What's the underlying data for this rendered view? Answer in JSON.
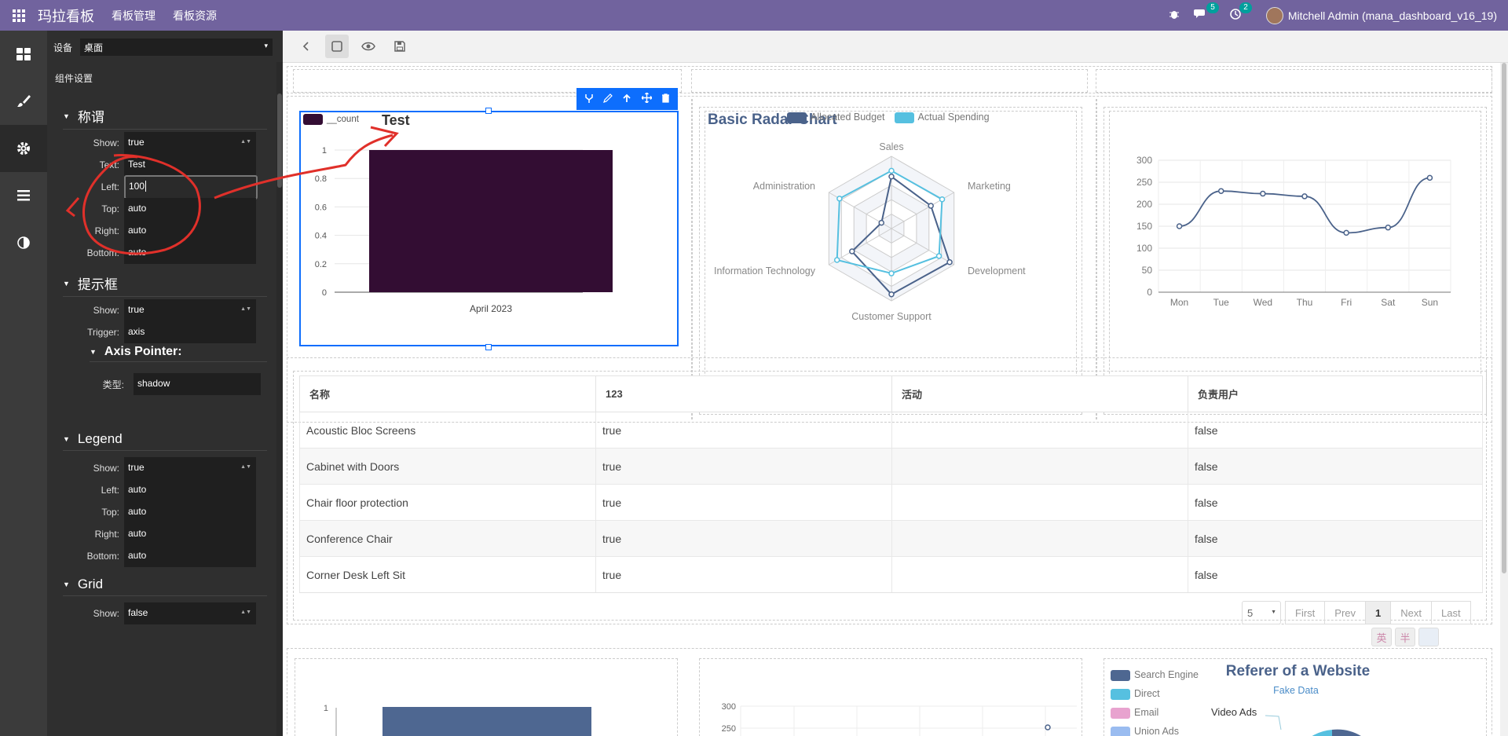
{
  "topbar": {
    "app_title": "玛拉看板",
    "menu": [
      "看板管理",
      "看板资源"
    ],
    "chat_badge": "5",
    "activity_badge": "2",
    "user": "Mitchell Admin (mana_dashboard_v16_19)"
  },
  "panel": {
    "device_label": "设备",
    "device_value": "桌面",
    "component_settings": "组件设置",
    "sections": {
      "title": {
        "heading": "称谓",
        "fields": [
          {
            "label": "Show:",
            "value": "true"
          },
          {
            "label": "Text:",
            "value": "Test"
          },
          {
            "label": "Left:",
            "value": "100"
          },
          {
            "label": "Top:",
            "value": "auto"
          },
          {
            "label": "Right:",
            "value": "auto"
          },
          {
            "label": "Bottom:",
            "value": "auto"
          }
        ]
      },
      "tooltip": {
        "heading": "提示框",
        "fields": [
          {
            "label": "Show:",
            "value": "true"
          },
          {
            "label": "Trigger:",
            "value": "axis"
          }
        ],
        "axis_pointer_heading": "Axis Pointer:",
        "axis_pointer_type_label": "类型:",
        "axis_pointer_type_value": "shadow"
      },
      "legend": {
        "heading": "Legend",
        "fields": [
          {
            "label": "Show:",
            "value": "true"
          },
          {
            "label": "Left:",
            "value": "auto"
          },
          {
            "label": "Top:",
            "value": "auto"
          },
          {
            "label": "Right:",
            "value": "auto"
          },
          {
            "label": "Bottom:",
            "value": "auto"
          }
        ]
      },
      "grid": {
        "heading": "Grid",
        "fields": [
          {
            "label": "Show:",
            "value": "false"
          }
        ]
      }
    }
  },
  "bar_widget": {
    "legend": "__count",
    "title": "Test",
    "y_ticks": [
      "1",
      "0.8",
      "0.6",
      "0.4",
      "0.2",
      "0"
    ],
    "x_label": "April 2023",
    "bar_color": "#330d33"
  },
  "radar_widget": {
    "title": "Basic Radar Chart",
    "legend": [
      "Allocated Budget",
      "Actual Spending"
    ],
    "indicators": [
      "Sales",
      "Marketing",
      "Development",
      "Customer Support",
      "Information Technology",
      "Administration"
    ]
  },
  "line_widget": {
    "y_ticks": [
      "300",
      "250",
      "200",
      "150",
      "100",
      "50",
      "0"
    ],
    "x_ticks": [
      "Mon",
      "Tue",
      "Wed",
      "Thu",
      "Fri",
      "Sat",
      "Sun"
    ]
  },
  "table_widget": {
    "headers": [
      "名称",
      "123",
      "活动",
      "负责用户"
    ],
    "rows": [
      [
        "Acoustic Bloc Screens",
        "true",
        "",
        "false"
      ],
      [
        "Cabinet with Doors",
        "true",
        "",
        "false"
      ],
      [
        "Chair floor protection",
        "true",
        "",
        "false"
      ],
      [
        "Conference Chair",
        "true",
        "",
        "false"
      ],
      [
        "Corner Desk Left Sit",
        "true",
        "",
        "false"
      ]
    ],
    "page_size": "5",
    "pager": [
      "First",
      "Prev",
      "1",
      "Next",
      "Last"
    ]
  },
  "bottom_bar_widget": {
    "y_tick": "1"
  },
  "bottom_line_widget": {
    "y_ticks": [
      "300",
      "250"
    ]
  },
  "pie_widget": {
    "title": "Referer of a Website",
    "subtitle": "Fake Data",
    "legend": [
      "Search Engine",
      "Direct",
      "Email",
      "Union Ads"
    ],
    "label": "Video Ads"
  },
  "ime_badges": [
    "英",
    "半"
  ],
  "colors": {
    "topbar": "#71639e",
    "accent": "#0d6efd",
    "annotation": "#e0302a",
    "series_dark": "#4a628a",
    "series_light": "#56c0e0"
  },
  "chart_data": [
    {
      "type": "bar",
      "title": "Test",
      "categories": [
        "April 2023"
      ],
      "series": [
        {
          "name": "__count",
          "values": [
            1
          ]
        }
      ],
      "ylim": [
        0,
        1
      ]
    },
    {
      "type": "radar",
      "title": "Basic Radar Chart",
      "indicators": [
        "Sales",
        "Marketing",
        "Development",
        "Customer Support",
        "Information Technology",
        "Administration"
      ],
      "series": [
        {
          "name": "Allocated Budget",
          "values": [
            0.72,
            0.63,
            0.93,
            0.91,
            0.63,
            0.16
          ]
        },
        {
          "name": "Actual Spending",
          "values": [
            0.8,
            0.81,
            0.76,
            0.62,
            0.87,
            0.83
          ]
        }
      ]
    },
    {
      "type": "line",
      "categories": [
        "Mon",
        "Tue",
        "Wed",
        "Thu",
        "Fri",
        "Sat",
        "Sun"
      ],
      "series": [
        {
          "values": [
            150,
            230,
            224,
            218,
            135,
            147,
            260
          ]
        }
      ],
      "ylim": [
        0,
        300
      ]
    }
  ]
}
